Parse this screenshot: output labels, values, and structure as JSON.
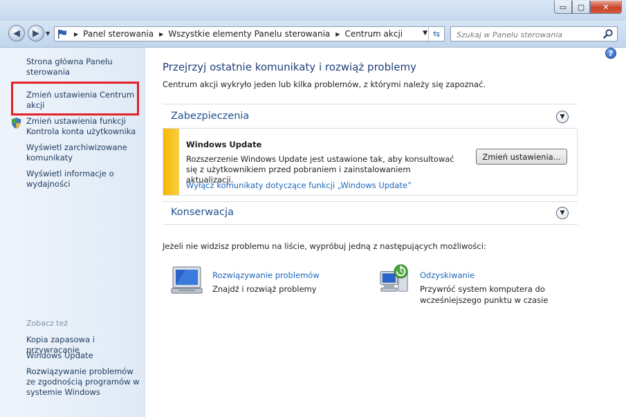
{
  "window": {
    "minimize_glyph": "▭",
    "maximize_glyph": "▢",
    "close_glyph": "✕"
  },
  "nav": {
    "back_glyph": "◀",
    "forward_glyph": "▶",
    "breadcrumbs": [
      "Panel sterowania",
      "Wszystkie elementy Panelu sterowania",
      "Centrum akcji"
    ],
    "search_placeholder": "Szukaj w Panelu sterowania"
  },
  "sidebar": {
    "links": [
      "Strona główna Panelu sterowania",
      "Zmień ustawienia Centrum akcji",
      "Zmień ustawienia funkcji Kontrola konta użytkownika",
      "Wyświetl zarchiwizowane komunikaty",
      "Wyświetl informacje o wydajności"
    ],
    "see_also_heading": "Zobacz też",
    "see_also": [
      "Kopia zapasowa i przywracanie",
      "Windows Update",
      "Rozwiązywanie problemów ze zgodnością programów w systemie Windows"
    ]
  },
  "main": {
    "title": "Przejrzyj ostatnie komunikaty i rozwiąż problemy",
    "subtitle": "Centrum akcji wykryło jeden lub kilka problemów, z którymi należy się zapoznać.",
    "sections": {
      "security": "Zabezpieczenia",
      "maintenance": "Konserwacja"
    },
    "alert": {
      "title": "Windows Update",
      "text": "Rozszerzenie Windows Update jest ustawione tak, aby konsultować się z użytkownikiem przed pobraniem i zainstalowaniem aktualizacji.",
      "link": "Wyłącz komunikaty dotyczące funkcji „Windows Update”",
      "button": "Zmień ustawienia..."
    },
    "prompt": "Jeżeli nie widzisz problemu na liście, wypróbuj jedną z następujących możliwości:",
    "tools": [
      {
        "title": "Rozwiązywanie problemów",
        "desc": "Znajdź i rozwiąż problemy",
        "icon": "troubleshoot-icon"
      },
      {
        "title": "Odzyskiwanie",
        "desc": "Przywróć system komputera do wcześniejszego punktu w czasie",
        "icon": "recovery-icon"
      }
    ]
  },
  "colors": {
    "accent_link": "#1e66b8",
    "title_blue": "#1e3c78",
    "alert_yellow": "#f5b800",
    "highlight_red": "#e32025"
  }
}
